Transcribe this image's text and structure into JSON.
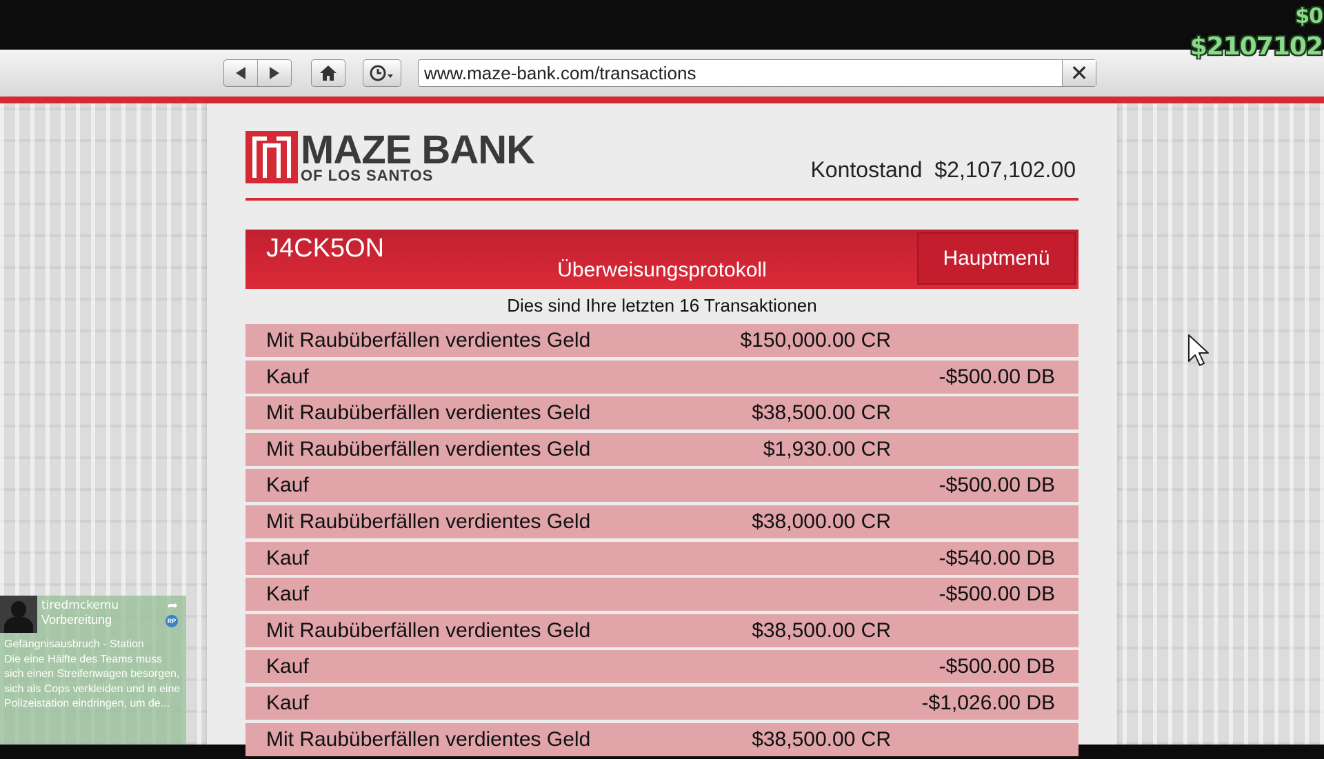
{
  "hud": {
    "cash": "$0",
    "bank": "$2107102"
  },
  "browser": {
    "url": "www.maze-bank.com/transactions"
  },
  "bank": {
    "logo_title": "MAZE BANK",
    "logo_sub": "OF LOS SANTOS",
    "balance_label": "Kontostand",
    "balance_value": "$2,107,102.00",
    "account_name": "J4CK5ON",
    "section_title": "Überweisungsprotokoll",
    "menu_button": "Hauptmenü",
    "subtitle": "Dies sind Ihre letzten 16 Transaktionen"
  },
  "transactions": [
    {
      "label": "Mit Raubüberfällen verdientes Geld",
      "credit": "$150,000.00 CR",
      "debit": ""
    },
    {
      "label": "Kauf",
      "credit": "",
      "debit": "-$500.00 DB"
    },
    {
      "label": "Mit Raubüberfällen verdientes Geld",
      "credit": "$38,500.00 CR",
      "debit": ""
    },
    {
      "label": "Mit Raubüberfällen verdientes Geld",
      "credit": "$1,930.00 CR",
      "debit": ""
    },
    {
      "label": "Kauf",
      "credit": "",
      "debit": "-$500.00 DB"
    },
    {
      "label": "Mit Raubüberfällen verdientes Geld",
      "credit": "$38,000.00 CR",
      "debit": ""
    },
    {
      "label": "Kauf",
      "credit": "",
      "debit": "-$540.00 DB"
    },
    {
      "label": "Kauf",
      "credit": "",
      "debit": "-$500.00 DB"
    },
    {
      "label": "Mit Raubüberfällen verdientes Geld",
      "credit": "$38,500.00 CR",
      "debit": ""
    },
    {
      "label": "Kauf",
      "credit": "",
      "debit": "-$500.00 DB"
    },
    {
      "label": "Kauf",
      "credit": "",
      "debit": "-$1,026.00 DB"
    },
    {
      "label": "Mit Raubüberfällen verdientes Geld",
      "credit": "$38,500.00 CR",
      "debit": ""
    }
  ],
  "notification": {
    "user": "tiredmckemu",
    "status": "Vorbereitung",
    "rp_badge": "RP",
    "text": "Gefängnisausbruch - Station\nDie eine Hälfte des Teams muss sich einen Streifenwagen besorgen, sich als Cops verkleiden und in eine Polizeistation eindringen, um de..."
  },
  "colors": {
    "brand_red": "#d42a35",
    "row_pink": "#e0a4a9",
    "hud_green": "#8cd98c"
  }
}
